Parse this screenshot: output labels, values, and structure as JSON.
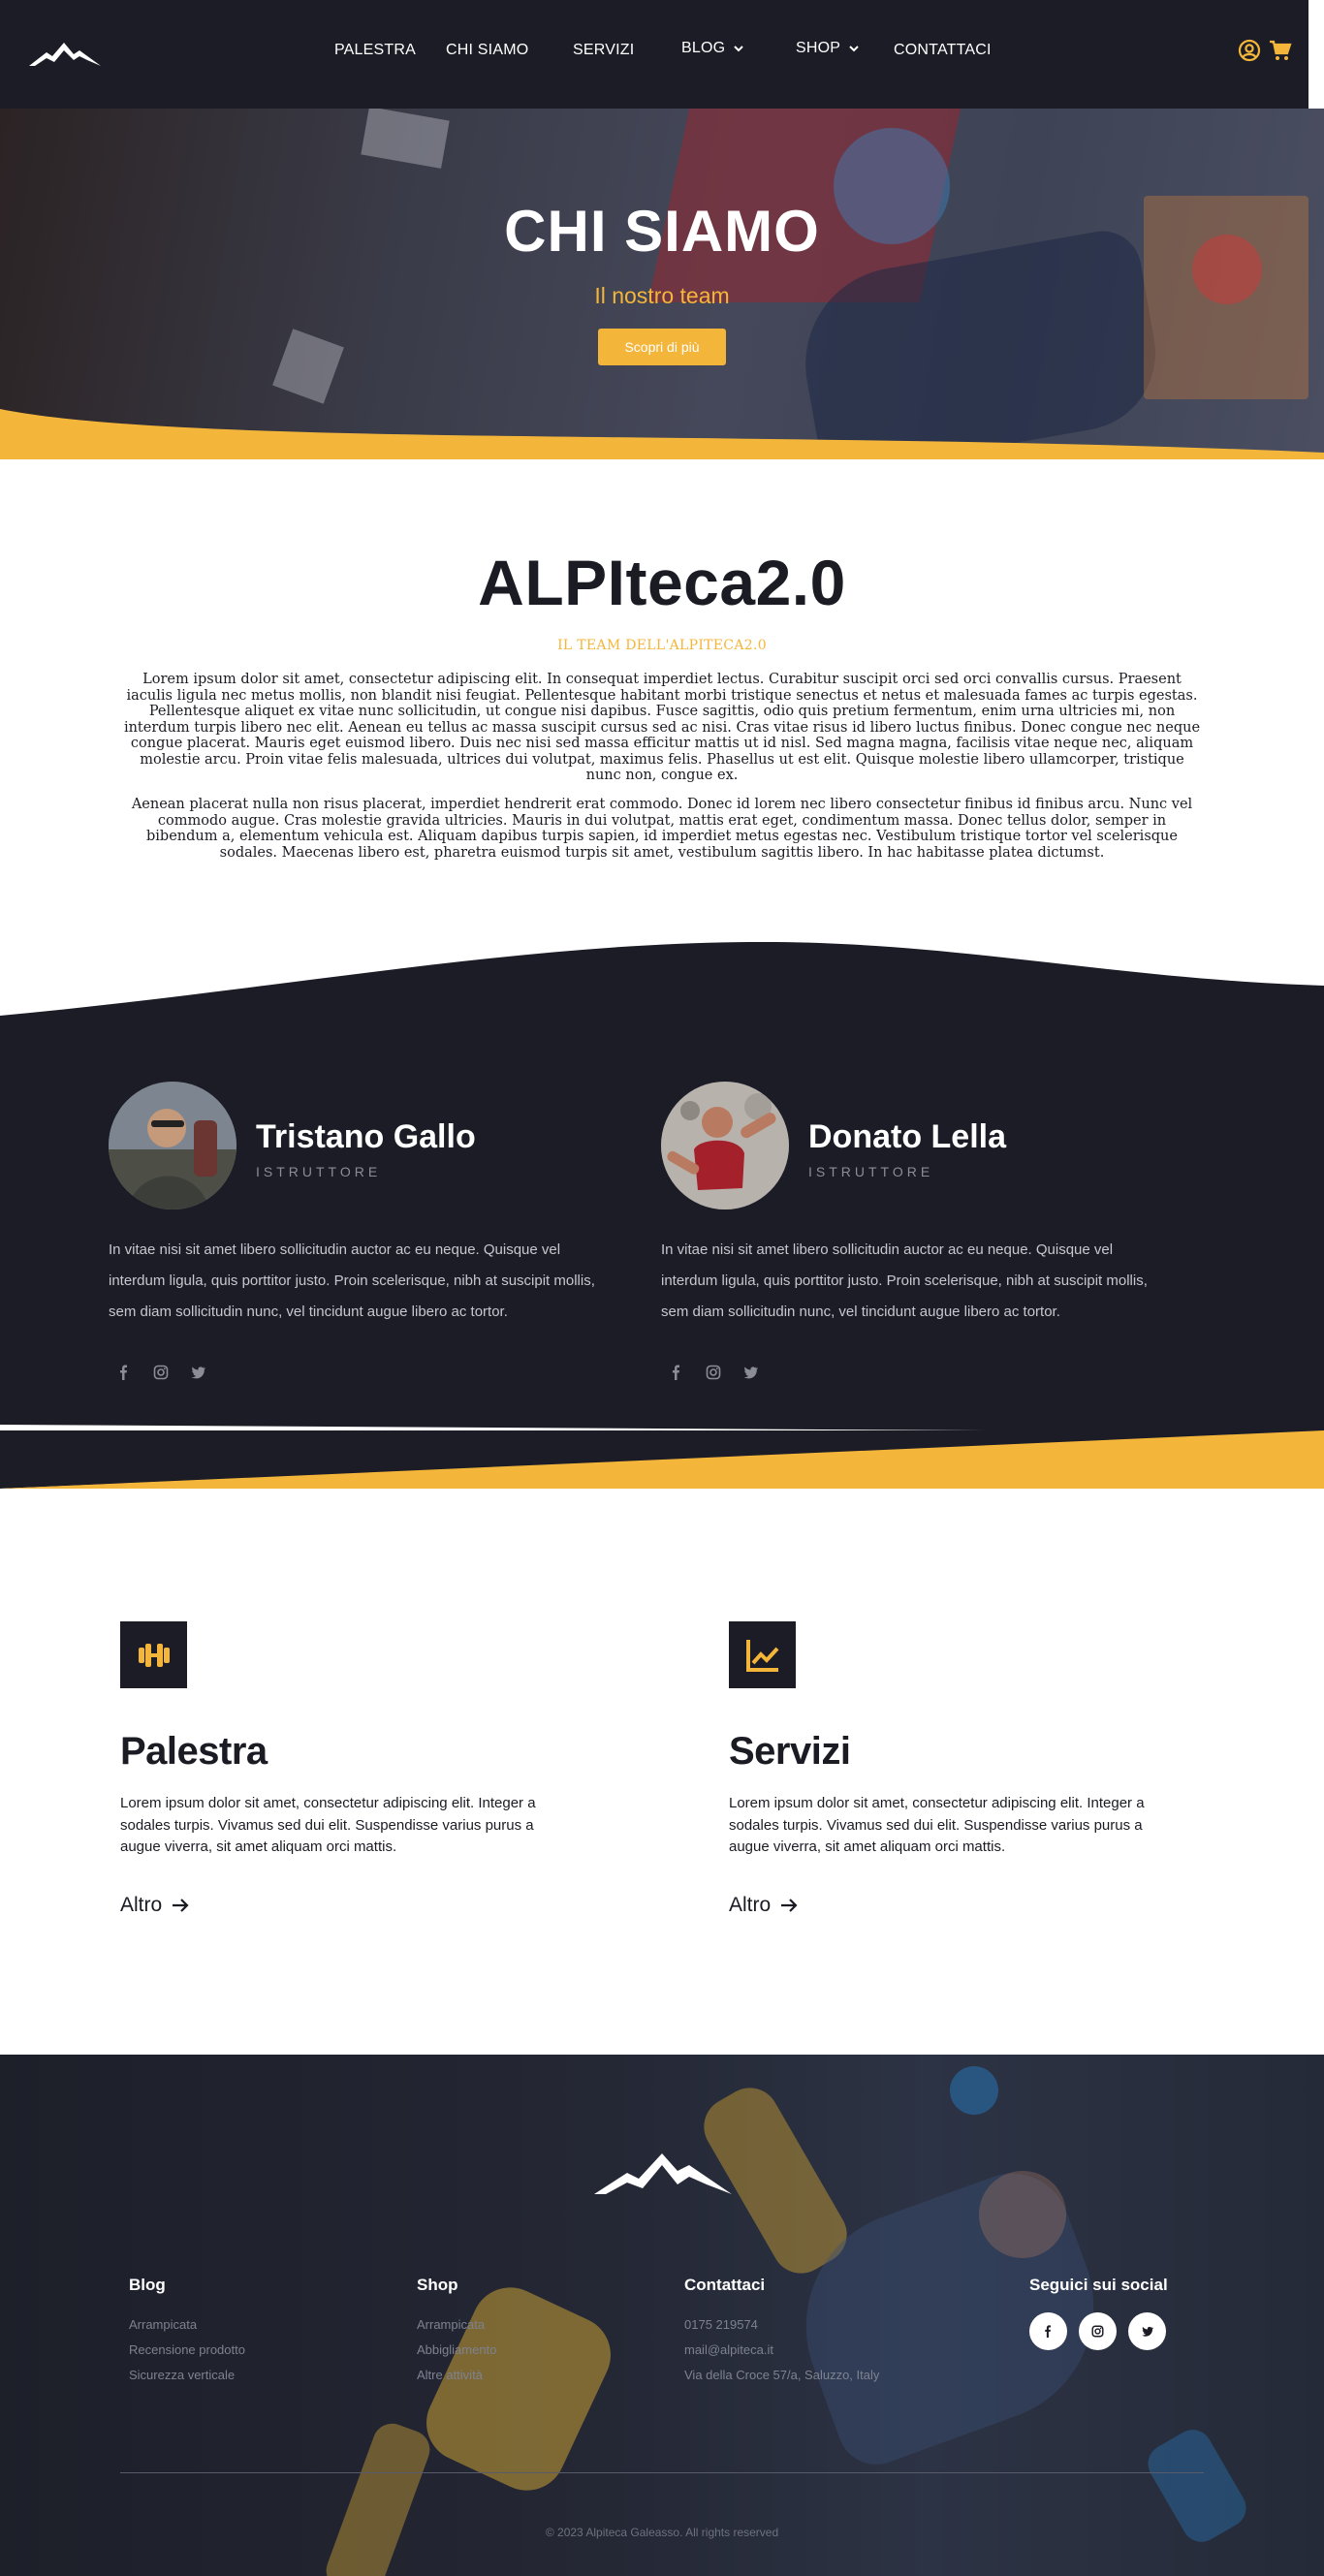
{
  "colors": {
    "accent": "#f4b63a",
    "dark": "#1c1c26",
    "white": "#ffffff"
  },
  "nav": {
    "logo_icon": "mountain-logo",
    "items": [
      {
        "label": "PALESTRA",
        "dropdown": false
      },
      {
        "label": "CHI SIAMO",
        "dropdown": false
      },
      {
        "label": "SERVIZI",
        "dropdown": false
      },
      {
        "label": "BLOG",
        "dropdown": true
      },
      {
        "label": "SHOP",
        "dropdown": true
      },
      {
        "label": "CONTATTACI",
        "dropdown": false
      }
    ],
    "icons": [
      "user-icon",
      "cart-icon"
    ]
  },
  "hero": {
    "title": "CHI SIAMO",
    "subtitle": "Il nostro team",
    "button_label": "Scopri di più"
  },
  "about": {
    "title": "ALPIteca2.0",
    "kicker": "IL TEAM DELL'ALPITECA2.0",
    "paragraph_1": "Lorem ipsum dolor sit amet, consectetur adipiscing elit. In consequat imperdiet lectus. Curabitur suscipit orci sed orci convallis cursus. Praesent iaculis ligula nec metus mollis, non blandit nisi feugiat. Pellentesque habitant morbi tristique senectus et netus et malesuada fames ac turpis egestas. Pellentesque aliquet ex vitae nunc sollicitudin, ut congue nisi dapibus. Fusce sagittis, odio quis pretium fermentum, enim urna ultricies mi, non interdum turpis libero nec elit. Aenean eu tellus ac massa suscipit cursus sed ac nisi. Cras vitae risus id libero luctus finibus. Donec congue nec neque congue placerat. Mauris eget euismod libero. Duis nec nisi sed massa efficitur mattis ut id nisl. Sed magna magna, facilisis vitae neque nec, aliquam molestie arcu. Proin vitae felis malesuada, ultrices dui volutpat, maximus felis. Phasellus ut est elit. Quisque molestie libero ullamcorper, tristique nunc non, congue ex.",
    "paragraph_2": "Aenean placerat nulla non risus placerat, imperdiet hendrerit erat commodo. Donec id lorem nec libero consectetur finibus id finibus arcu. Nunc vel commodo augue. Cras molestie gravida ultricies. Mauris in dui volutpat, mattis erat eget, condimentum massa. Donec tellus dolor, semper in bibendum a, elementum vehicula est. Aliquam dapibus turpis sapien, id imperdiet metus egestas nec. Vestibulum tristique tortor vel scelerisque sodales. Maecenas libero est, pharetra euismod turpis sit amet, vestibulum sagittis libero. In hac habitasse platea dictumst."
  },
  "team": [
    {
      "name": "Tristano Gallo",
      "role": "ISTRUTTORE",
      "bio": "In vitae nisi sit amet libero sollicitudin auctor ac eu neque. Quisque vel interdum ligula, quis porttitor justo. Proin scelerisque, nibh at suscipit mollis, sem diam sollicitudin nunc, vel tincidunt augue libero ac tortor.",
      "social": [
        "facebook-icon",
        "instagram-icon",
        "twitter-icon"
      ]
    },
    {
      "name": "Donato Lella",
      "role": "ISTRUTTORE",
      "bio": "In vitae nisi sit amet libero sollicitudin auctor ac eu neque. Quisque vel interdum ligula, quis porttitor justo. Proin scelerisque, nibh at suscipit mollis, sem diam sollicitudin nunc, vel tincidunt augue libero ac tortor.",
      "social": [
        "facebook-icon",
        "instagram-icon",
        "twitter-icon"
      ]
    }
  ],
  "features": [
    {
      "icon": "dumbbell-icon",
      "title": "Palestra",
      "text": "Lorem ipsum dolor sit amet, consectetur adipiscing elit. Integer a sodales turpis. Vivamus sed dui elit. Suspendisse varius purus a augue viverra, sit amet aliquam orci mattis.",
      "link_label": "Altro"
    },
    {
      "icon": "chart-line-icon",
      "title": "Servizi",
      "text": "Lorem ipsum dolor sit amet, consectetur adipiscing elit. Integer a sodales turpis. Vivamus sed dui elit. Suspendisse varius purus a augue viverra, sit amet aliquam orci mattis.",
      "link_label": "Altro"
    }
  ],
  "footer": {
    "blog": {
      "heading": "Blog",
      "links": [
        "Arrampicata",
        "Recensione prodotto",
        "Sicurezza verticale"
      ]
    },
    "shop": {
      "heading": "Shop",
      "links": [
        "Arrampicata",
        "Abbigliamento",
        "Altre attività"
      ]
    },
    "contact": {
      "heading": "Contattaci",
      "lines": [
        "0175 219574",
        "mail@alpiteca.it",
        "Via della Croce 57/a, Saluzzo, Italy"
      ]
    },
    "social": {
      "heading": "Seguici sui social",
      "icons": [
        "facebook-icon",
        "instagram-icon",
        "twitter-icon"
      ]
    },
    "copyright": "© 2023 Alpiteca Galeasso. All rights reserved"
  }
}
